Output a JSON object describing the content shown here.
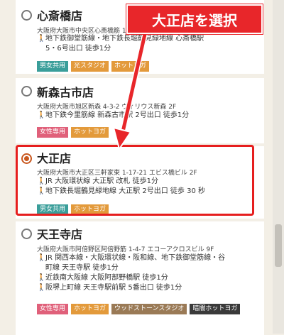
{
  "stores": [
    {
      "name": "心斎橋店",
      "address": "大阪府大阪市中央区心斎橋筋 1-4-29 フェリチタ心斎橋 3F",
      "access": [
        "地下鉄御堂筋線・地下鉄長堀鶴見緑地線 心斎橋駅",
        "5・6号出口 徒歩1分"
      ],
      "tags": [
        {
          "label": "男女共用",
          "color": "#3a9e9a"
        },
        {
          "label": "光スタジオ",
          "color": "#e39a3b"
        },
        {
          "label": "ホットヨガ",
          "color": "#e39a3b"
        }
      ],
      "checked": false
    },
    {
      "name": "新森古市店",
      "address": "大阪府大阪市旭区新森 4-3-2 ヴィリウス新森 2F",
      "access": [
        "地下鉄今里筋線 新森古市駅 2号出口 徒歩1分"
      ],
      "tags": [
        {
          "label": "女性専用",
          "color": "#e0607a"
        },
        {
          "label": "ホットヨガ",
          "color": "#e39a3b"
        }
      ],
      "checked": false
    },
    {
      "name": "大正店",
      "address": "大阪府大阪市大正区三軒家東 1-17-21 エビス橋ビル 2F",
      "access": [
        "JR 大阪環状線 大正駅 改札 徒歩1分",
        "地下鉄長堀鶴見緑地線 大正駅 2号出口 徒歩 30 秒"
      ],
      "tags": [
        {
          "label": "男女共用",
          "color": "#3a9e9a"
        },
        {
          "label": "ホットヨガ",
          "color": "#e39a3b"
        }
      ],
      "checked": true
    },
    {
      "name": "天王寺店",
      "address": "大阪府大阪市阿倍野区阿倍野筋 1-4-7 エコーアクロスビル 9F",
      "access": [
        "JR 関西本線・大阪環状線・阪和線、地下鉄御堂筋線・谷",
        "町線 天王寺駅 徒歩1分",
        "近鉄南大阪線 大阪阿部野橋駅 徒歩1分",
        "阪堺上町線 天王寺駅前駅 5番出口 徒歩1分"
      ],
      "tags": [
        {
          "label": "女性専用",
          "color": "#e0607a"
        },
        {
          "label": "ホットヨガ",
          "color": "#e39a3b"
        },
        {
          "label": "ウッドストーンスタジオ",
          "color": "#9a7a56"
        },
        {
          "label": "暗闇ホットヨガ",
          "color": "#3a3a3a"
        }
      ],
      "checked": false
    }
  ],
  "callout": "大正店を選択",
  "icons": {
    "walk": "walking-person-icon"
  }
}
